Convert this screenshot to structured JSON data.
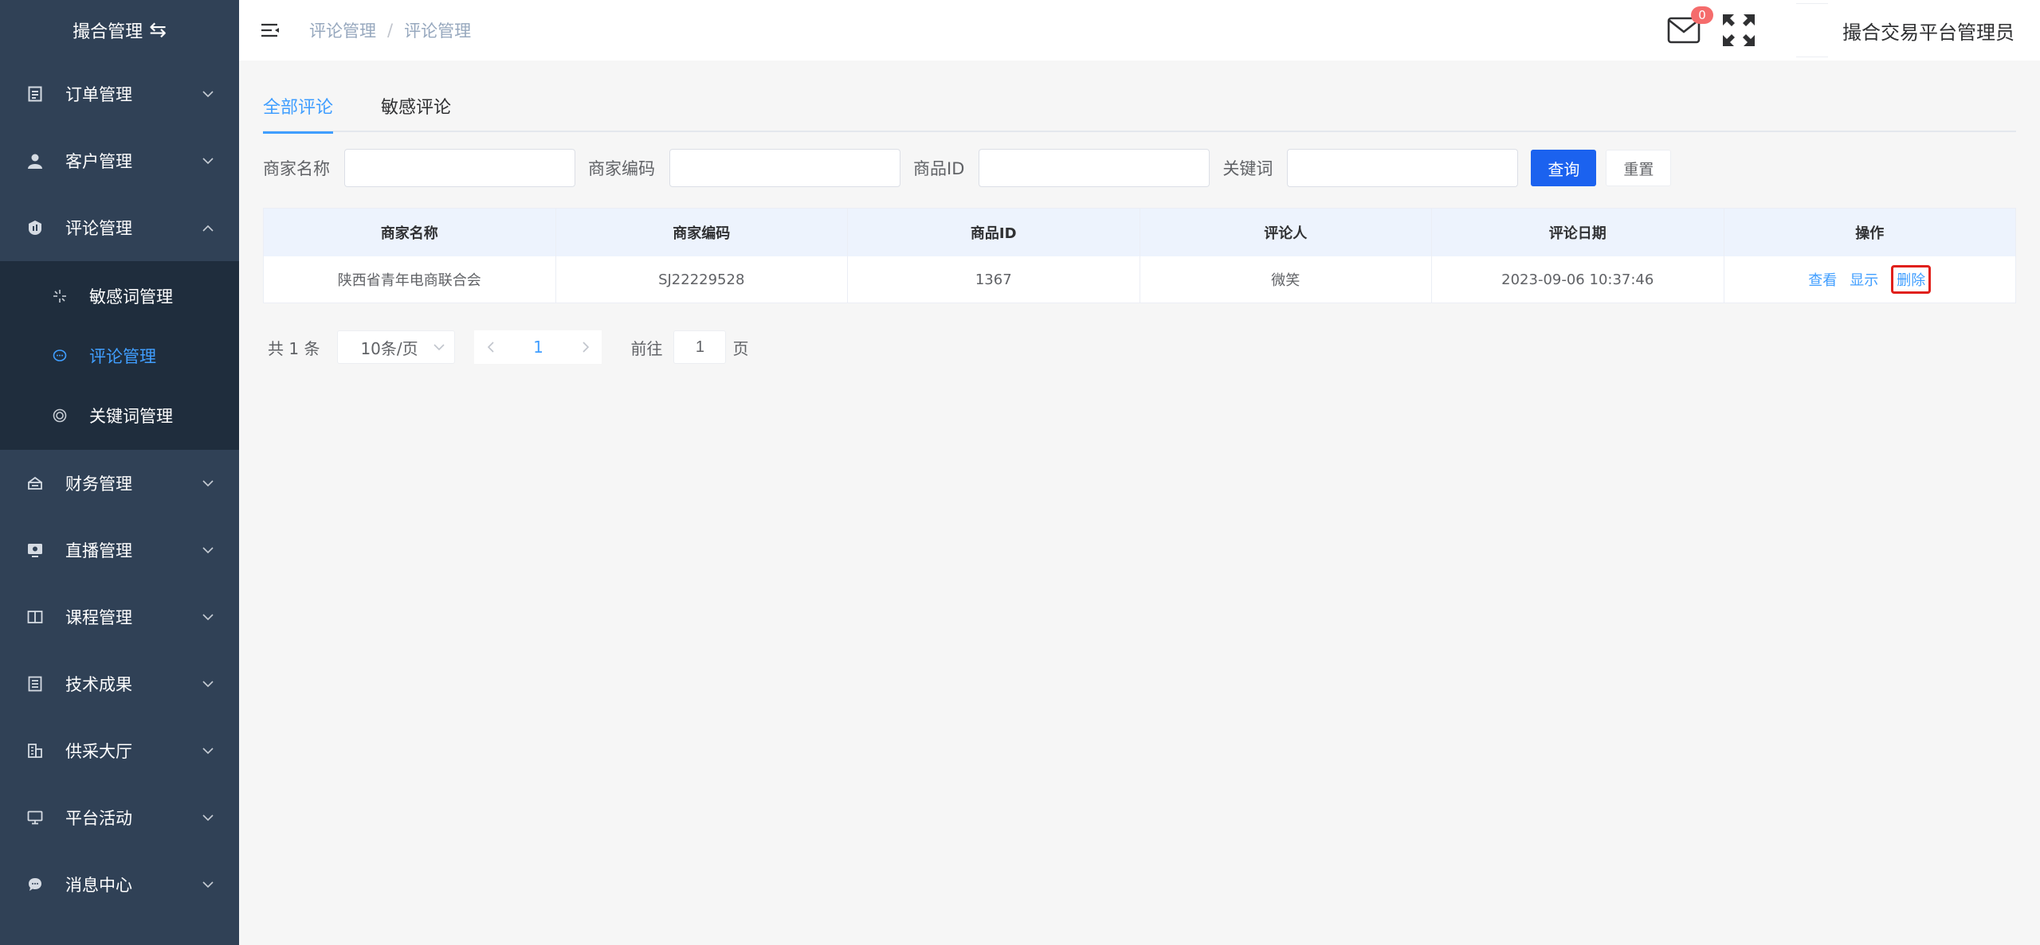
{
  "sidebar": {
    "logo_text": "撮合管理",
    "menu": [
      {
        "label": "订单管理"
      },
      {
        "label": "客户管理"
      },
      {
        "label": "评论管理"
      },
      {
        "label": "财务管理"
      },
      {
        "label": "直播管理"
      },
      {
        "label": "课程管理"
      },
      {
        "label": "技术成果"
      },
      {
        "label": "供采大厅"
      },
      {
        "label": "平台活动"
      },
      {
        "label": "消息中心"
      }
    ],
    "submenu": [
      {
        "label": "敏感词管理"
      },
      {
        "label": "评论管理",
        "active": true
      },
      {
        "label": "关键词管理"
      }
    ]
  },
  "header": {
    "breadcrumb": [
      "评论管理",
      "评论管理"
    ],
    "breadcrumb_sep": "/",
    "mail_badge": "0",
    "username": "撮合交易平台管理员"
  },
  "tabs": [
    {
      "label": "全部评论",
      "active": true
    },
    {
      "label": "敏感评论"
    }
  ],
  "filters": {
    "merchant_name_label": "商家名称",
    "merchant_code_label": "商家编码",
    "product_id_label": "商品ID",
    "keyword_label": "关键词",
    "query_button": "查询",
    "reset_button": "重置"
  },
  "table": {
    "columns": [
      "商家名称",
      "商家编码",
      "商品ID",
      "评论人",
      "评论日期",
      "操作"
    ],
    "rows": [
      {
        "merchant_name": "陕西省青年电商联合会",
        "merchant_code": "SJ22229528",
        "product_id": "1367",
        "commenter": "微笑",
        "date": "2023-09-06 10:37:46",
        "actions": [
          "查看",
          "显示",
          "删除"
        ]
      }
    ]
  },
  "pagination": {
    "total": "共 1 条",
    "page_size": "10条/页",
    "current_page": "1",
    "goto_label": "前往",
    "goto_value": "1",
    "page_suffix": "页"
  },
  "colors": {
    "sidebar_bg": "#304156",
    "submenu_bg": "#1f2d3d",
    "accent": "#409eff",
    "primary_button": "#1b62ef",
    "badge": "#f56c6c",
    "highlight_border": "#e0201b"
  }
}
